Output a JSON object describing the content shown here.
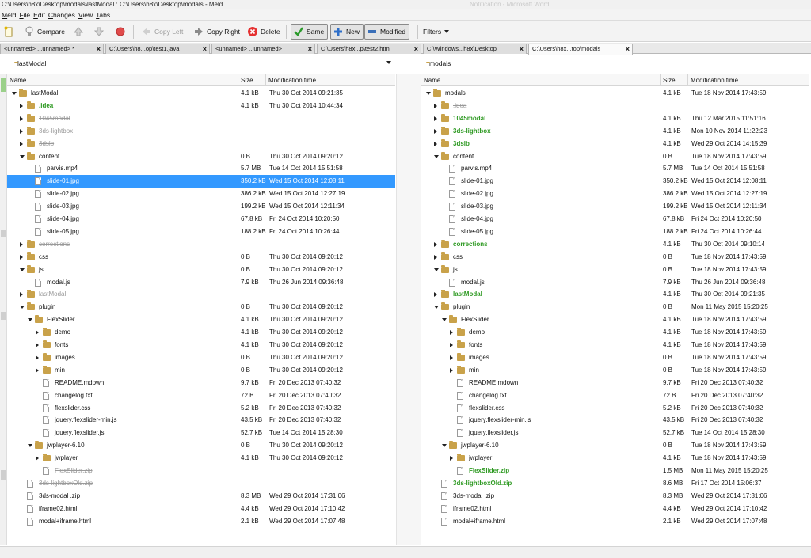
{
  "window": {
    "title": "C:\\Users\\h8x\\Desktop\\modals\\lastModal : C:\\Users\\h8x\\Desktop\\modals - Meld",
    "ghost_title": "Notification - Microsoft Word"
  },
  "menu": [
    "Meld",
    "File",
    "Edit",
    "Changes",
    "View",
    "Tabs"
  ],
  "toolbar": {
    "compare": "Compare",
    "copy_left": "Copy Left",
    "copy_right": "Copy Right",
    "delete": "Delete",
    "same": "Same",
    "new": "New",
    "modified": "Modified",
    "filters": "Filters"
  },
  "tabs": [
    {
      "label": "<unnamed> ...unnamed> *"
    },
    {
      "label": "C:\\Users\\h8...op\\test1.java"
    },
    {
      "label": "<unnamed> ...unnamed>"
    },
    {
      "label": "C:\\Users\\h8x...p\\test2.html"
    },
    {
      "label": "C:\\Windows...h8x\\Desktop"
    },
    {
      "label": "C:\\Users\\h8x...top\\modals"
    }
  ],
  "colors": {
    "selection": "#3399ff",
    "new": "#2f9a23",
    "missing": "#9a9a9a",
    "folder": "#c9a24a"
  },
  "left": {
    "path": "lastModal",
    "headers": {
      "name": "Name",
      "size": "Size",
      "mtime": "Modification time"
    },
    "rows": [
      {
        "name": "lastModal",
        "size": "4.1 kB",
        "mtime": "Thu 30 Oct 2014 09:21:35",
        "type": "folder",
        "depth": 0,
        "tw": "open",
        "state": "normal"
      },
      {
        "name": ".idea",
        "size": "4.1 kB",
        "mtime": "Thu 30 Oct 2014 10:44:34",
        "type": "folder",
        "depth": 1,
        "tw": "closed",
        "state": "new"
      },
      {
        "name": "1045modal",
        "size": "",
        "mtime": "",
        "type": "folder",
        "depth": 1,
        "tw": "closed",
        "state": "missing"
      },
      {
        "name": "3ds-lightbox",
        "size": "",
        "mtime": "",
        "type": "folder",
        "depth": 1,
        "tw": "closed",
        "state": "missing"
      },
      {
        "name": "3dslb",
        "size": "",
        "mtime": "",
        "type": "folder",
        "depth": 1,
        "tw": "closed",
        "state": "missing"
      },
      {
        "name": "content",
        "size": "0 B",
        "mtime": "Thu 30 Oct 2014 09:20:12",
        "type": "folder",
        "depth": 1,
        "tw": "open",
        "state": "normal"
      },
      {
        "name": "parvis.mp4",
        "size": "5.7 MB",
        "mtime": "Tue 14 Oct 2014 15:51:58",
        "type": "file",
        "depth": 2,
        "tw": "",
        "state": "normal"
      },
      {
        "name": "slide-01.jpg",
        "size": "350.2 kB",
        "mtime": "Wed 15 Oct 2014 12:08:11",
        "type": "file",
        "depth": 2,
        "tw": "",
        "state": "selected"
      },
      {
        "name": "slide-02.jpg",
        "size": "386.2 kB",
        "mtime": "Wed 15 Oct 2014 12:27:19",
        "type": "file",
        "depth": 2,
        "tw": "",
        "state": "normal"
      },
      {
        "name": "slide-03.jpg",
        "size": "199.2 kB",
        "mtime": "Wed 15 Oct 2014 12:11:34",
        "type": "file",
        "depth": 2,
        "tw": "",
        "state": "normal"
      },
      {
        "name": "slide-04.jpg",
        "size": "67.8 kB",
        "mtime": "Fri 24 Oct 2014 10:20:50",
        "type": "file",
        "depth": 2,
        "tw": "",
        "state": "normal"
      },
      {
        "name": "slide-05.jpg",
        "size": "188.2 kB",
        "mtime": "Fri 24 Oct 2014 10:26:44",
        "type": "file",
        "depth": 2,
        "tw": "",
        "state": "normal"
      },
      {
        "name": "corrections",
        "size": "",
        "mtime": "",
        "type": "folder",
        "depth": 1,
        "tw": "closed",
        "state": "missing"
      },
      {
        "name": "css",
        "size": "0 B",
        "mtime": "Thu 30 Oct 2014 09:20:12",
        "type": "folder",
        "depth": 1,
        "tw": "closed",
        "state": "normal"
      },
      {
        "name": "js",
        "size": "0 B",
        "mtime": "Thu 30 Oct 2014 09:20:12",
        "type": "folder",
        "depth": 1,
        "tw": "open",
        "state": "normal"
      },
      {
        "name": "modal.js",
        "size": "7.9 kB",
        "mtime": "Thu 26 Jun 2014 09:36:48",
        "type": "file",
        "depth": 2,
        "tw": "",
        "state": "normal"
      },
      {
        "name": "lastModal",
        "size": "",
        "mtime": "",
        "type": "folder",
        "depth": 1,
        "tw": "closed",
        "state": "missing"
      },
      {
        "name": "plugin",
        "size": "0 B",
        "mtime": "Thu 30 Oct 2014 09:20:12",
        "type": "folder",
        "depth": 1,
        "tw": "open",
        "state": "normal"
      },
      {
        "name": "FlexSlider",
        "size": "4.1 kB",
        "mtime": "Thu 30 Oct 2014 09:20:12",
        "type": "folder",
        "depth": 2,
        "tw": "open",
        "state": "normal"
      },
      {
        "name": "demo",
        "size": "4.1 kB",
        "mtime": "Thu 30 Oct 2014 09:20:12",
        "type": "folder",
        "depth": 3,
        "tw": "closed",
        "state": "normal"
      },
      {
        "name": "fonts",
        "size": "4.1 kB",
        "mtime": "Thu 30 Oct 2014 09:20:12",
        "type": "folder",
        "depth": 3,
        "tw": "closed",
        "state": "normal"
      },
      {
        "name": "images",
        "size": "0 B",
        "mtime": "Thu 30 Oct 2014 09:20:12",
        "type": "folder",
        "depth": 3,
        "tw": "closed",
        "state": "normal"
      },
      {
        "name": "min",
        "size": "0 B",
        "mtime": "Thu 30 Oct 2014 09:20:12",
        "type": "folder",
        "depth": 3,
        "tw": "closed",
        "state": "normal"
      },
      {
        "name": "README.mdown",
        "size": "9.7 kB",
        "mtime": "Fri 20 Dec 2013 07:40:32",
        "type": "file",
        "depth": 3,
        "tw": "",
        "state": "normal"
      },
      {
        "name": "changelog.txt",
        "size": "72 B",
        "mtime": "Fri 20 Dec 2013 07:40:32",
        "type": "file",
        "depth": 3,
        "tw": "",
        "state": "normal"
      },
      {
        "name": "flexslider.css",
        "size": "5.2 kB",
        "mtime": "Fri 20 Dec 2013 07:40:32",
        "type": "file",
        "depth": 3,
        "tw": "",
        "state": "normal"
      },
      {
        "name": "jquery.flexslider-min.js",
        "size": "43.5 kB",
        "mtime": "Fri 20 Dec 2013 07:40:32",
        "type": "file",
        "depth": 3,
        "tw": "",
        "state": "normal"
      },
      {
        "name": "jquery.flexslider.js",
        "size": "52.7 kB",
        "mtime": "Tue 14 Oct 2014 15:28:30",
        "type": "file",
        "depth": 3,
        "tw": "",
        "state": "normal"
      },
      {
        "name": "jwplayer-6.10",
        "size": "0 B",
        "mtime": "Thu 30 Oct 2014 09:20:12",
        "type": "folder",
        "depth": 2,
        "tw": "open",
        "state": "normal"
      },
      {
        "name": "jwplayer",
        "size": "4.1 kB",
        "mtime": "Thu 30 Oct 2014 09:20:12",
        "type": "folder",
        "depth": 3,
        "tw": "closed",
        "state": "normal"
      },
      {
        "name": "FlexSlider.zip",
        "size": "",
        "mtime": "",
        "type": "file",
        "depth": 3,
        "tw": "",
        "state": "missing"
      },
      {
        "name": "3ds-lightboxOld.zip",
        "size": "",
        "mtime": "",
        "type": "file",
        "depth": 1,
        "tw": "",
        "state": "missing"
      },
      {
        "name": "3ds-modal .zip",
        "size": "8.3 MB",
        "mtime": "Wed 29 Oct 2014 17:31:06",
        "type": "file",
        "depth": 1,
        "tw": "",
        "state": "normal"
      },
      {
        "name": "iframe02.html",
        "size": "4.4 kB",
        "mtime": "Wed 29 Oct 2014 17:10:42",
        "type": "file",
        "depth": 1,
        "tw": "",
        "state": "normal"
      },
      {
        "name": "modal+iframe.html",
        "size": "2.1 kB",
        "mtime": "Wed 29 Oct 2014 17:07:48",
        "type": "file",
        "depth": 1,
        "tw": "",
        "state": "normal"
      }
    ]
  },
  "right": {
    "path": "modals",
    "headers": {
      "name": "Name",
      "size": "Size",
      "mtime": "Modification time"
    },
    "rows": [
      {
        "name": "modals",
        "size": "4.1 kB",
        "mtime": "Tue 18 Nov 2014 17:43:59",
        "type": "folder",
        "depth": 0,
        "tw": "open",
        "state": "normal"
      },
      {
        "name": ".idea",
        "size": "",
        "mtime": "",
        "type": "folder",
        "depth": 1,
        "tw": "closed",
        "state": "missing"
      },
      {
        "name": "1045modal",
        "size": "4.1 kB",
        "mtime": "Thu 12 Mar 2015 11:51:16",
        "type": "folder",
        "depth": 1,
        "tw": "closed",
        "state": "new"
      },
      {
        "name": "3ds-lightbox",
        "size": "4.1 kB",
        "mtime": "Mon 10 Nov 2014 11:22:23",
        "type": "folder",
        "depth": 1,
        "tw": "closed",
        "state": "new"
      },
      {
        "name": "3dslb",
        "size": "4.1 kB",
        "mtime": "Wed 29 Oct 2014 14:15:39",
        "type": "folder",
        "depth": 1,
        "tw": "closed",
        "state": "new"
      },
      {
        "name": "content",
        "size": "0 B",
        "mtime": "Tue 18 Nov 2014 17:43:59",
        "type": "folder",
        "depth": 1,
        "tw": "open",
        "state": "normal"
      },
      {
        "name": "parvis.mp4",
        "size": "5.7 MB",
        "mtime": "Tue 14 Oct 2014 15:51:58",
        "type": "file",
        "depth": 2,
        "tw": "",
        "state": "normal"
      },
      {
        "name": "slide-01.jpg",
        "size": "350.2 kB",
        "mtime": "Wed 15 Oct 2014 12:08:11",
        "type": "file",
        "depth": 2,
        "tw": "",
        "state": "normal"
      },
      {
        "name": "slide-02.jpg",
        "size": "386.2 kB",
        "mtime": "Wed 15 Oct 2014 12:27:19",
        "type": "file",
        "depth": 2,
        "tw": "",
        "state": "normal"
      },
      {
        "name": "slide-03.jpg",
        "size": "199.2 kB",
        "mtime": "Wed 15 Oct 2014 12:11:34",
        "type": "file",
        "depth": 2,
        "tw": "",
        "state": "normal"
      },
      {
        "name": "slide-04.jpg",
        "size": "67.8 kB",
        "mtime": "Fri 24 Oct 2014 10:20:50",
        "type": "file",
        "depth": 2,
        "tw": "",
        "state": "normal"
      },
      {
        "name": "slide-05.jpg",
        "size": "188.2 kB",
        "mtime": "Fri 24 Oct 2014 10:26:44",
        "type": "file",
        "depth": 2,
        "tw": "",
        "state": "normal"
      },
      {
        "name": "corrections",
        "size": "4.1 kB",
        "mtime": "Thu 30 Oct 2014 09:10:14",
        "type": "folder",
        "depth": 1,
        "tw": "closed",
        "state": "new"
      },
      {
        "name": "css",
        "size": "0 B",
        "mtime": "Tue 18 Nov 2014 17:43:59",
        "type": "folder",
        "depth": 1,
        "tw": "closed",
        "state": "normal"
      },
      {
        "name": "js",
        "size": "0 B",
        "mtime": "Tue 18 Nov 2014 17:43:59",
        "type": "folder",
        "depth": 1,
        "tw": "open",
        "state": "normal"
      },
      {
        "name": "modal.js",
        "size": "7.9 kB",
        "mtime": "Thu 26 Jun 2014 09:36:48",
        "type": "file",
        "depth": 2,
        "tw": "",
        "state": "normal"
      },
      {
        "name": "lastModal",
        "size": "4.1 kB",
        "mtime": "Thu 30 Oct 2014 09:21:35",
        "type": "folder",
        "depth": 1,
        "tw": "closed",
        "state": "new"
      },
      {
        "name": "plugin",
        "size": "0 B",
        "mtime": "Mon 11 May 2015 15:20:25",
        "type": "folder",
        "depth": 1,
        "tw": "open",
        "state": "normal"
      },
      {
        "name": "FlexSlider",
        "size": "4.1 kB",
        "mtime": "Tue 18 Nov 2014 17:43:59",
        "type": "folder",
        "depth": 2,
        "tw": "open",
        "state": "normal"
      },
      {
        "name": "demo",
        "size": "4.1 kB",
        "mtime": "Tue 18 Nov 2014 17:43:59",
        "type": "folder",
        "depth": 3,
        "tw": "closed",
        "state": "normal"
      },
      {
        "name": "fonts",
        "size": "4.1 kB",
        "mtime": "Tue 18 Nov 2014 17:43:59",
        "type": "folder",
        "depth": 3,
        "tw": "closed",
        "state": "normal"
      },
      {
        "name": "images",
        "size": "0 B",
        "mtime": "Tue 18 Nov 2014 17:43:59",
        "type": "folder",
        "depth": 3,
        "tw": "closed",
        "state": "normal"
      },
      {
        "name": "min",
        "size": "0 B",
        "mtime": "Tue 18 Nov 2014 17:43:59",
        "type": "folder",
        "depth": 3,
        "tw": "closed",
        "state": "normal"
      },
      {
        "name": "README.mdown",
        "size": "9.7 kB",
        "mtime": "Fri 20 Dec 2013 07:40:32",
        "type": "file",
        "depth": 3,
        "tw": "",
        "state": "normal"
      },
      {
        "name": "changelog.txt",
        "size": "72 B",
        "mtime": "Fri 20 Dec 2013 07:40:32",
        "type": "file",
        "depth": 3,
        "tw": "",
        "state": "normal"
      },
      {
        "name": "flexslider.css",
        "size": "5.2 kB",
        "mtime": "Fri 20 Dec 2013 07:40:32",
        "type": "file",
        "depth": 3,
        "tw": "",
        "state": "normal"
      },
      {
        "name": "jquery.flexslider-min.js",
        "size": "43.5 kB",
        "mtime": "Fri 20 Dec 2013 07:40:32",
        "type": "file",
        "depth": 3,
        "tw": "",
        "state": "normal"
      },
      {
        "name": "jquery.flexslider.js",
        "size": "52.7 kB",
        "mtime": "Tue 14 Oct 2014 15:28:30",
        "type": "file",
        "depth": 3,
        "tw": "",
        "state": "normal"
      },
      {
        "name": "jwplayer-6.10",
        "size": "0 B",
        "mtime": "Tue 18 Nov 2014 17:43:59",
        "type": "folder",
        "depth": 2,
        "tw": "open",
        "state": "normal"
      },
      {
        "name": "jwplayer",
        "size": "4.1 kB",
        "mtime": "Tue 18 Nov 2014 17:43:59",
        "type": "folder",
        "depth": 3,
        "tw": "closed",
        "state": "normal"
      },
      {
        "name": "FlexSlider.zip",
        "size": "1.5 MB",
        "mtime": "Mon 11 May 2015 15:20:25",
        "type": "file",
        "depth": 3,
        "tw": "",
        "state": "new"
      },
      {
        "name": "3ds-lightboxOld.zip",
        "size": "8.6 MB",
        "mtime": "Fri 17 Oct 2014 15:06:37",
        "type": "file",
        "depth": 1,
        "tw": "",
        "state": "new"
      },
      {
        "name": "3ds-modal .zip",
        "size": "8.3 MB",
        "mtime": "Wed 29 Oct 2014 17:31:06",
        "type": "file",
        "depth": 1,
        "tw": "",
        "state": "normal"
      },
      {
        "name": "iframe02.html",
        "size": "4.4 kB",
        "mtime": "Wed 29 Oct 2014 17:10:42",
        "type": "file",
        "depth": 1,
        "tw": "",
        "state": "normal"
      },
      {
        "name": "modal+iframe.html",
        "size": "2.1 kB",
        "mtime": "Wed 29 Oct 2014 17:07:48",
        "type": "file",
        "depth": 1,
        "tw": "",
        "state": "normal"
      }
    ]
  }
}
